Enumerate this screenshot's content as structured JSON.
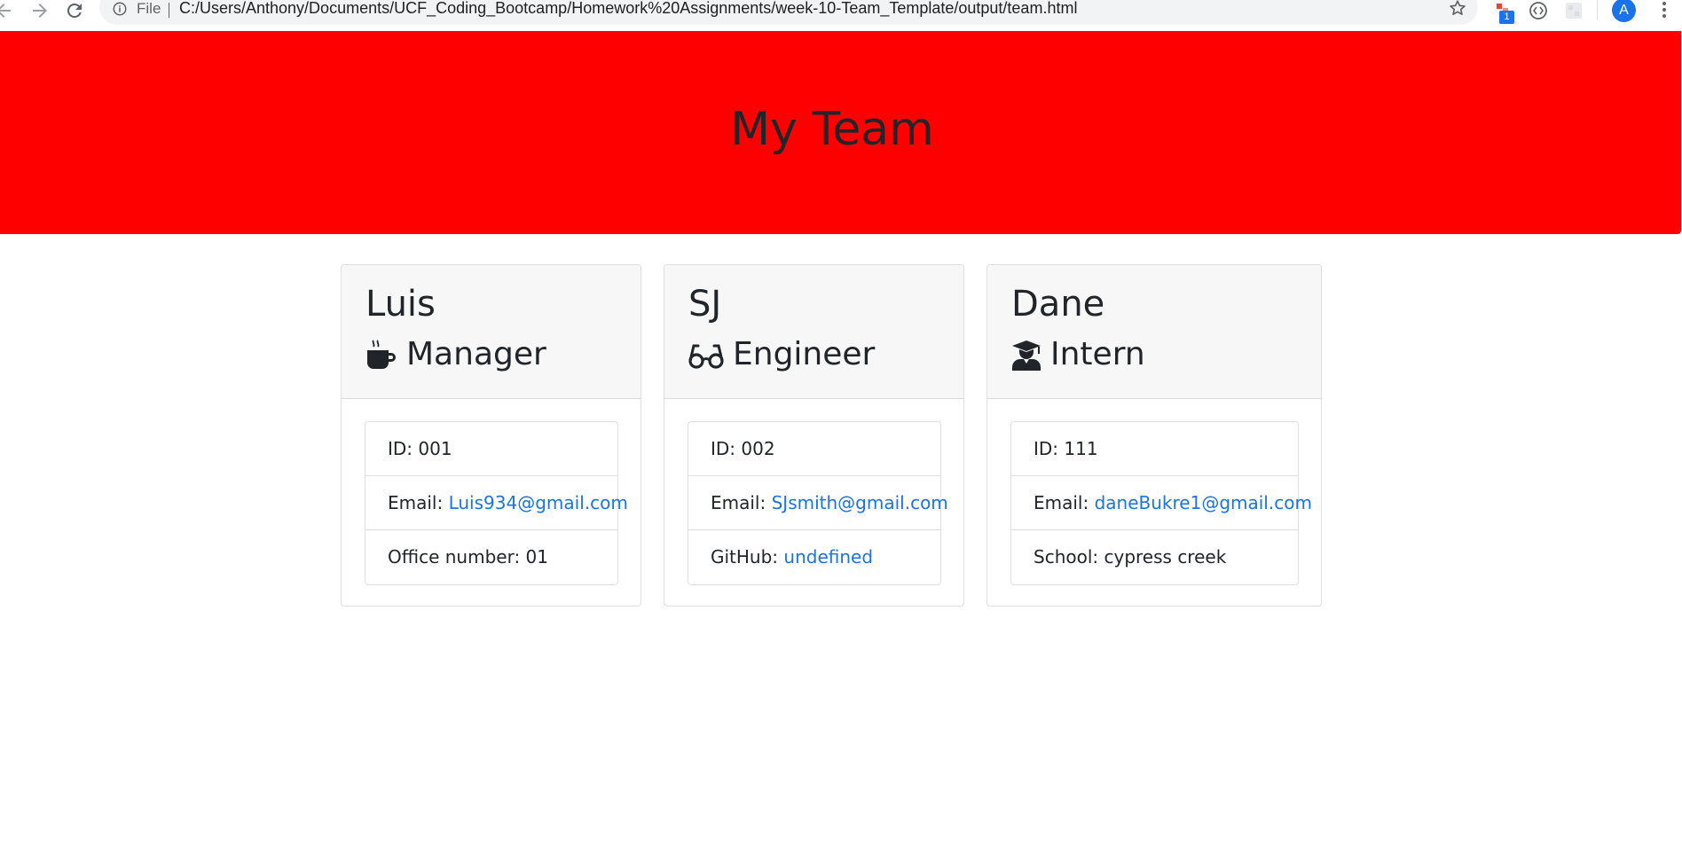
{
  "browser": {
    "scheme_label": "File",
    "url": "C:/Users/Anthony/Documents/UCF_Coding_Bootcamp/Homework%20Assignments/week-10-Team_Template/output/team.html",
    "extension_badge": "1",
    "profile_initial": "A"
  },
  "page": {
    "title": "My Team",
    "header_color": "#ff0000"
  },
  "cards": [
    {
      "name": "Luis",
      "role": "Manager",
      "icon": "mug-icon",
      "id_label": "ID: ",
      "id_value": "001",
      "email_label": "Email: ",
      "email_value": "Luis934@gmail.com",
      "extra_label": "Office number: ",
      "extra_value": "01"
    },
    {
      "name": "SJ",
      "role": "Engineer",
      "icon": "glasses-icon",
      "id_label": "ID: ",
      "id_value": "002",
      "email_label": "Email: ",
      "email_value": "SJsmith@gmail.com",
      "extra_label": "GitHub: ",
      "extra_value": "undefined"
    },
    {
      "name": "Dane",
      "role": "Intern",
      "icon": "graduate-icon",
      "id_label": "ID: ",
      "id_value": "111",
      "email_label": "Email: ",
      "email_value": "daneBukre1@gmail.com",
      "extra_label": "School: ",
      "extra_value": "cypress creek"
    }
  ],
  "colors": {
    "link": "#1a73e8",
    "card_header_bg": "#f7f7f7"
  }
}
